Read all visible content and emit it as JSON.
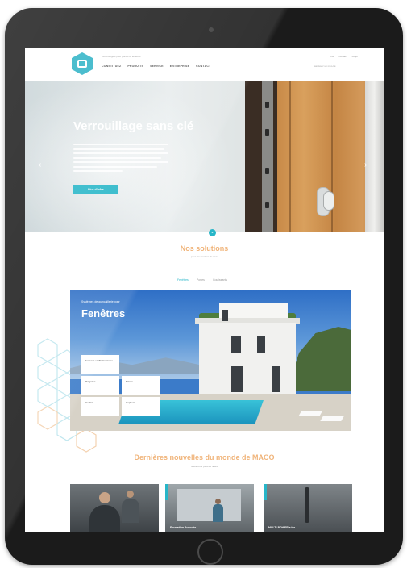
{
  "header": {
    "tagline": "Technologies pour portes et fenêtres",
    "nav": [
      "CONSTITUEZ",
      "PRODUITS",
      "SERVICE",
      "ENTREPRISE",
      "CONTACT"
    ],
    "util": [
      "FR",
      "Contact",
      "Login"
    ],
    "search_placeholder": "Saisissez un mot-clé"
  },
  "hero": {
    "title": "Verrouillage sans clé",
    "button": "Plus d'infos",
    "prev": "‹",
    "next": "›"
  },
  "solutions": {
    "title": "Nos solutions",
    "subtitle": "pour une maison de rêve",
    "tabs": [
      "Fenêtres",
      "Portes",
      "Coulissants"
    ],
    "card_label": "Systèmes de quincaillerie pour",
    "card_title": "Fenêtres",
    "tiles": [
      "Ferrures oscillo-battantes",
      "Poignées",
      "Sûreté",
      "Confort",
      "Capteurs"
    ]
  },
  "news": {
    "title": "Dernières nouvelles du monde de MACO",
    "subtitle": "rechercher plus de news",
    "cards": [
      "",
      "Formation Avancée",
      "MULTI-POWER sûre"
    ]
  },
  "colors": {
    "accent": "#27b6c8",
    "heading": "#f0b47a"
  }
}
